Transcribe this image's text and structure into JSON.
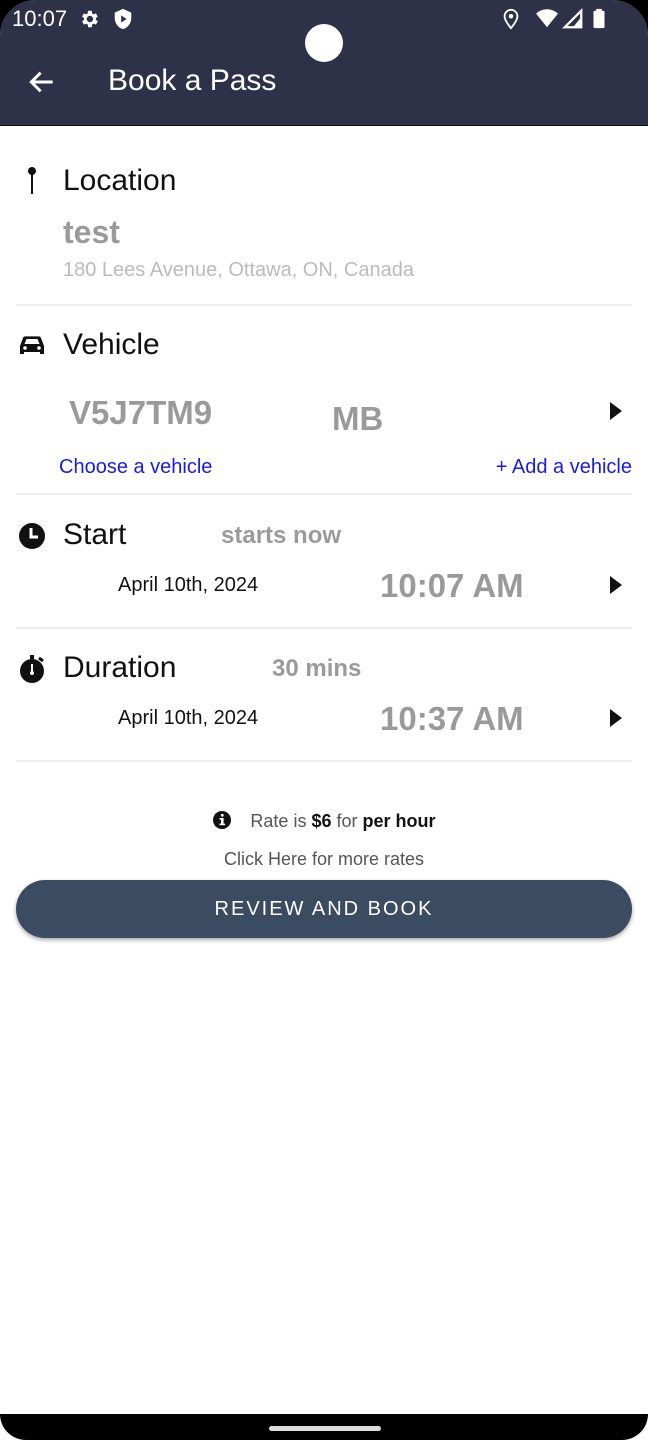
{
  "status_bar": {
    "time": "10:07",
    "left_icons": [
      "gear-icon",
      "shield-play-icon"
    ],
    "right_icons": [
      "location-icon",
      "wifi-icon",
      "signal-icon",
      "battery-icon"
    ]
  },
  "app_bar": {
    "back_icon": "arrow-left-icon",
    "title": "Book a Pass",
    "color": "#2e3249"
  },
  "location": {
    "icon": "pin-icon",
    "label": "Location",
    "name": "test",
    "address": "180 Lees Avenue, Ottawa, ON, Canada"
  },
  "vehicle": {
    "icon": "car-icon",
    "label": "Vehicle",
    "plate": "V5J7TM9",
    "province": "MB",
    "choose_link": "Choose a vehicle",
    "add_link": "+ Add a vehicle",
    "link_color": "#1a1ae8"
  },
  "start": {
    "icon": "clock-icon",
    "label": "Start",
    "note": "starts now",
    "date": "April 10th, 2024",
    "time": "10:07 AM"
  },
  "duration": {
    "icon": "stopwatch-icon",
    "label": "Duration",
    "value": "30 mins",
    "date": "April 10th, 2024",
    "time": "10:37 AM"
  },
  "rate": {
    "icon": "info-icon",
    "prefix": "Rate is",
    "amount": "$6",
    "middle": "for",
    "unit": "per hour",
    "more_link": "Click Here for more rates"
  },
  "actions": {
    "review_button": "REVIEW AND BOOK",
    "button_color": "#3b4b61"
  }
}
